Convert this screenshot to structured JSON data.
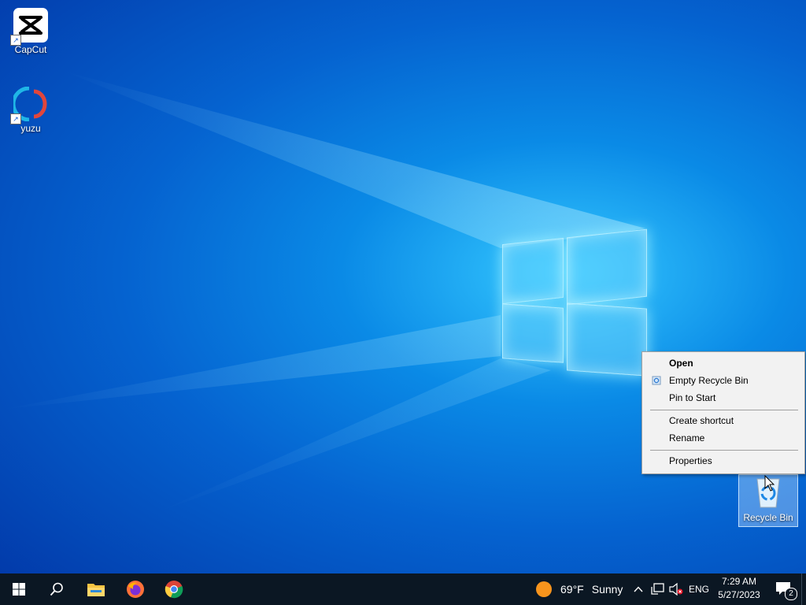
{
  "desktop": {
    "icons": [
      {
        "label": "CapCut",
        "icon": "capcut-icon"
      },
      {
        "label": "yuzu",
        "icon": "yuzu-icon"
      },
      {
        "label": "Recycle Bin",
        "icon": "recycle-bin-icon"
      }
    ]
  },
  "context_menu": {
    "items": [
      {
        "label": "Open",
        "bold": true
      },
      {
        "label": "Empty Recycle Bin",
        "icon": "recycle-icon"
      },
      {
        "label": "Pin to Start"
      },
      {
        "label": "Create shortcut"
      },
      {
        "label": "Rename"
      },
      {
        "label": "Properties"
      }
    ]
  },
  "taskbar": {
    "apps": [
      "start-icon",
      "search-icon",
      "file-explorer-icon",
      "firefox-icon",
      "chrome-icon"
    ],
    "weather": {
      "temp": "69°F",
      "condition": "Sunny",
      "icon": "sun-icon"
    },
    "tray": {
      "language": "ENG"
    },
    "clock": {
      "time": "7:29 AM",
      "date": "5/27/2023"
    },
    "notifications": {
      "count": "2"
    }
  },
  "colors": {
    "taskbar": "#0b1723",
    "menu_bg": "#f2f2f2",
    "desktop_accent": "#0a8ae6"
  }
}
